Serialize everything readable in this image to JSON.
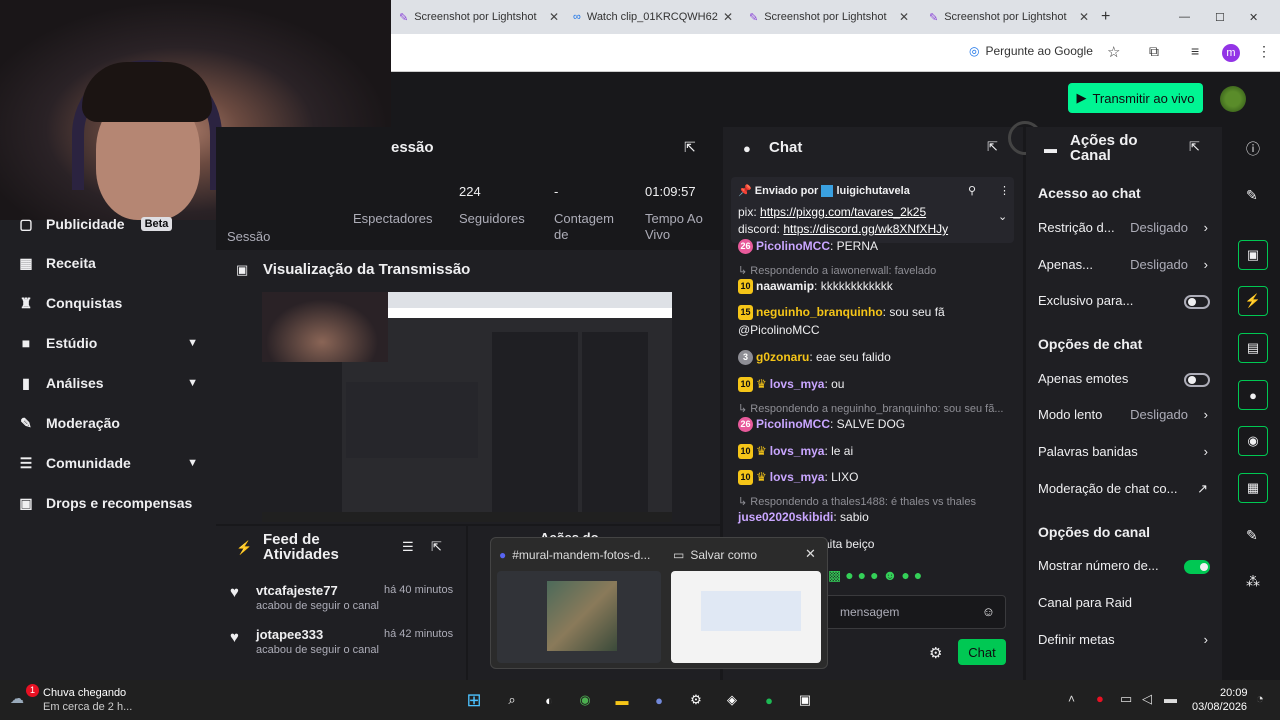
{
  "browser": {
    "tabs": [
      {
        "label": "Screenshot por Lightshot"
      },
      {
        "label": "Watch clip_01KRCQWH62"
      },
      {
        "label": "Screenshot por Lightshot"
      },
      {
        "label": "Screenshot por Lightshot"
      }
    ],
    "ask_google": "Pergunte ao Google",
    "profile_initial": "m"
  },
  "topbar": {
    "live_button": "Transmitir ao vivo"
  },
  "sidebar": {
    "items": [
      {
        "label": "Publicidade",
        "badge": "Beta"
      },
      {
        "label": "Receita"
      },
      {
        "label": "Conquistas"
      },
      {
        "label": "Estúdio"
      },
      {
        "label": "Análises"
      },
      {
        "label": "Moderação"
      },
      {
        "label": "Comunidade"
      },
      {
        "label": "Drops e recompensas"
      }
    ]
  },
  "stats": {
    "title": "essão",
    "spectators_label": "Espectadores",
    "followers_value": "224",
    "followers_label": "Seguidores",
    "count_value": "-",
    "count_label_1": "Contagem",
    "count_label_2": "de",
    "time_value": "01:09:57",
    "time_label_1": "Tempo Ao",
    "time_label_2": "Vivo",
    "session_label": "Sessão"
  },
  "preview": {
    "title": "Visualização da Transmissão"
  },
  "feed": {
    "title_1": "Feed de",
    "title_2": "Atividades",
    "items": [
      {
        "user": "vtcafajeste77",
        "time": "há 40 minutos",
        "action": "acabou de seguir o canal"
      },
      {
        "user": "jotapee333",
        "time": "há 42 minutos",
        "action": "acabou de seguir o canal"
      }
    ],
    "second_title": "Ações do"
  },
  "chat": {
    "title": "Chat",
    "pinned_by_label": "Enviado por",
    "pinned_by_user": "luigichutavela",
    "pinned_line1_prefix": "pix:",
    "pinned_line1_link": "https://pixgg.com/tavares_2k25",
    "pinned_line2_prefix": "discord:",
    "pinned_line2_link": "https://discord.gg/wk8XNfXHJy",
    "m1_badge": "26",
    "m1_user": "PicolinoMCC",
    "m1_text": ": PERNA",
    "r1": "Respondendo a iawonerwall: favelado",
    "m2_badge": "10",
    "m2_user": "naawamip",
    "m2_text": ": kkkkkkkkkkkk",
    "m3_badge": "15",
    "m3_user": "neguinho_branquinho",
    "m3_text": ": sou seu fã @PicolinoMCC",
    "m4_badge": "3",
    "m4_user": "g0zonaru",
    "m4_text": ": eae seu falido",
    "m5_badge": "10",
    "m5_user": "lovs_mya",
    "m5_text": ": ou",
    "r2": "Respondendo a neguinho_branquinho: sou seu fã...",
    "m6_badge": "26",
    "m6_user": "PicolinoMCC",
    "m6_text": ": SALVE DOG",
    "m7_badge": "10",
    "m7_user": "lovs_mya",
    "m7_text": ": le ai",
    "m8_badge": "10",
    "m8_user": "lovs_mya",
    "m8_text": ": LIXO",
    "r3": "Respondendo a thales1488: é thales vs thales",
    "m9_user": "juse02020skibidi",
    "m9_text": ": sabio",
    "m10_text": "aita beiço",
    "input_placeholder": "mensagem",
    "send_label": "Chat"
  },
  "actions": {
    "title_1": "Ações do",
    "title_2": "Canal",
    "sec_access": "Acesso ao chat",
    "restriction_label": "Restrição d...",
    "restriction_value": "Desligado",
    "only_label": "Apenas...",
    "only_value": "Desligado",
    "exclusive_label": "Exclusivo para...",
    "sec_chat_options": "Opções de chat",
    "emotes_label": "Apenas emotes",
    "slow_label": "Modo lento",
    "slow_value": "Desligado",
    "banned_label": "Palavras banidas",
    "mod_label": "Moderação de chat co...",
    "sec_channel_options": "Opções do canal",
    "show_count_label": "Mostrar número de...",
    "raid_label": "Canal para Raid",
    "goals_label": "Definir metas"
  },
  "popup": {
    "discord_title": "#mural-mandem-fotos-d...",
    "save_title": "Salvar como"
  },
  "taskbar": {
    "weather_title": "Chuva chegando",
    "weather_sub": "Em cerca de 2 h...",
    "weather_badge": "1",
    "time": "20:09",
    "date": "03/08/2026"
  },
  "colors": {
    "accent": "#00f593",
    "brand": "#00c853",
    "sub_gold": "#f5c518",
    "username": "#c9a6ff"
  }
}
